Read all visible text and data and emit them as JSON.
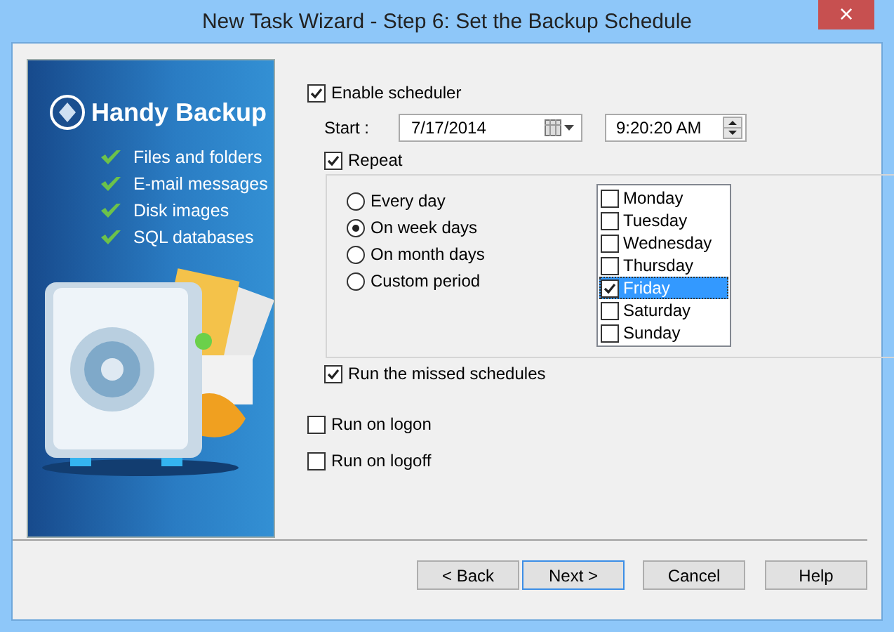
{
  "window": {
    "title": "New Task Wizard - Step 6: Set the Backup Schedule",
    "close": "×"
  },
  "banner": {
    "product": "Handy Backup",
    "features": [
      "Files and folders",
      "E-mail messages",
      "Disk images",
      "SQL databases"
    ]
  },
  "scheduler": {
    "enable": {
      "label": "Enable scheduler",
      "checked": true
    },
    "start": {
      "label": "Start :",
      "date": "7/17/2014",
      "time": "9:20:20 AM"
    },
    "repeat": {
      "label": "Repeat",
      "checked": true
    },
    "modes": [
      {
        "label": "Every day",
        "selected": false
      },
      {
        "label": "On week days",
        "selected": true
      },
      {
        "label": "On month days",
        "selected": false
      },
      {
        "label": "Custom period",
        "selected": false
      }
    ],
    "days": [
      {
        "label": "Monday",
        "checked": false,
        "selected": false
      },
      {
        "label": "Tuesday",
        "checked": false,
        "selected": false
      },
      {
        "label": "Wednesday",
        "checked": false,
        "selected": false
      },
      {
        "label": "Thursday",
        "checked": false,
        "selected": false
      },
      {
        "label": "Friday",
        "checked": true,
        "selected": true
      },
      {
        "label": "Saturday",
        "checked": false,
        "selected": false
      },
      {
        "label": "Sunday",
        "checked": false,
        "selected": false
      }
    ],
    "run_missed": {
      "label": "Run the missed schedules",
      "checked": true
    }
  },
  "options": [
    {
      "label": "Run on logon",
      "checked": false
    },
    {
      "label": "Run on logoff",
      "checked": false
    }
  ],
  "buttons": [
    {
      "label": "< Back",
      "default": false
    },
    {
      "label": "Next >",
      "default": true
    },
    {
      "label": "Cancel",
      "default": false
    },
    {
      "label": "Help",
      "default": false
    }
  ]
}
